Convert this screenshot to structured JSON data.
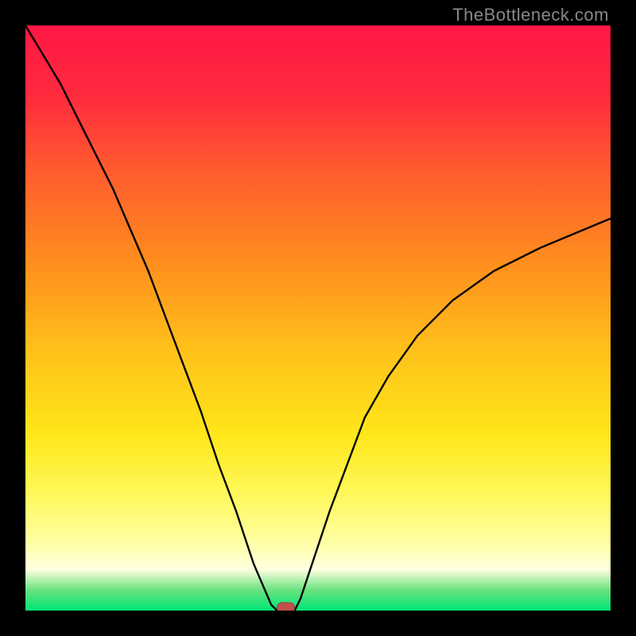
{
  "watermark": {
    "text": "TheBottleneck.com"
  },
  "colors": {
    "gradient_stops": [
      {
        "offset": 0.0,
        "color": "#ff1744"
      },
      {
        "offset": 0.12,
        "color": "#ff2a3e"
      },
      {
        "offset": 0.25,
        "color": "#ff5c2e"
      },
      {
        "offset": 0.4,
        "color": "#ff8c1f"
      },
      {
        "offset": 0.55,
        "color": "#ffbf1a"
      },
      {
        "offset": 0.7,
        "color": "#ffe71a"
      },
      {
        "offset": 0.8,
        "color": "#fff85a"
      },
      {
        "offset": 0.88,
        "color": "#ffffa0"
      },
      {
        "offset": 0.93,
        "color": "#ffffe0"
      },
      {
        "offset": 0.965,
        "color": "#68e27f"
      },
      {
        "offset": 1.0,
        "color": "#00e676"
      }
    ],
    "curve": "#000000",
    "marker_fill": "#c0504d",
    "marker_stroke": "#9a3f3d"
  },
  "chart_data": {
    "type": "line",
    "title": "",
    "xlabel": "",
    "ylabel": "",
    "x": [
      0.0,
      0.03,
      0.06,
      0.09,
      0.12,
      0.15,
      0.18,
      0.21,
      0.24,
      0.27,
      0.3,
      0.33,
      0.36,
      0.39,
      0.42,
      0.43,
      0.44,
      0.46,
      0.47,
      0.49,
      0.52,
      0.55,
      0.58,
      0.62,
      0.67,
      0.73,
      0.8,
      0.88,
      1.0
    ],
    "values": [
      1.0,
      0.95,
      0.9,
      0.84,
      0.78,
      0.72,
      0.65,
      0.58,
      0.5,
      0.42,
      0.34,
      0.25,
      0.17,
      0.08,
      0.01,
      0.0,
      0.0,
      0.0,
      0.02,
      0.08,
      0.17,
      0.25,
      0.33,
      0.4,
      0.47,
      0.53,
      0.58,
      0.62,
      0.67
    ],
    "xlim": [
      0,
      1
    ],
    "ylim": [
      0,
      1
    ],
    "marker": {
      "x": 0.445,
      "y": 0.0
    }
  }
}
